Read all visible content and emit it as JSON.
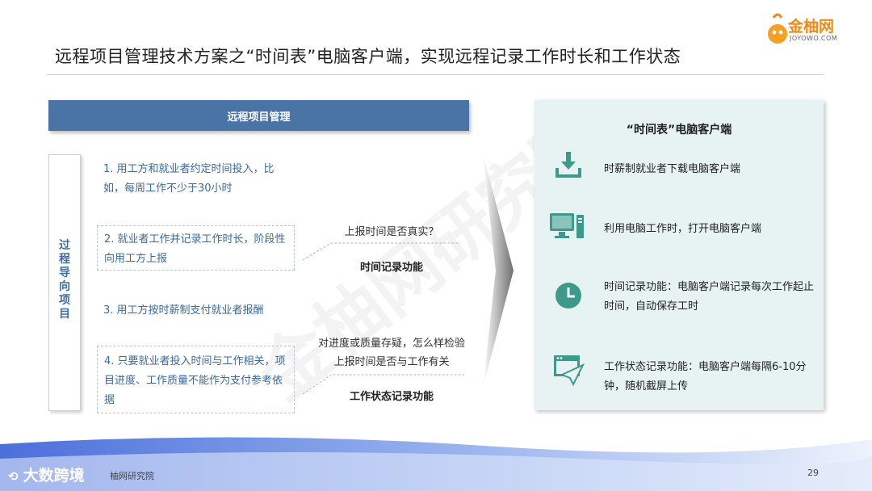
{
  "header": {
    "title": "远程项目管理技术方案之“时间表”电脑客户端，实现远程记录工作时长和工作状态",
    "logo_text": "金柚网",
    "logo_sub": "JOYOWO.COM"
  },
  "left": {
    "bar_title": "远程项目管理",
    "vertical_label": "过程导向项目",
    "steps": [
      "1.  用工方和就业者约定时间投入，比如，每周工作不少于30小时",
      "2. 就业者工作并记录工作时长，阶段性向用工方上报",
      "3. 用工方按时薪制支付就业者报酬",
      "4. 只要就业者投入时间与工作相关，项目进度、工作质量不能作为支付参考依据"
    ]
  },
  "middle": {
    "q1": "上报时间是否真实？",
    "f1": "时间记录功能",
    "q2": "对进度或质量存疑，怎么样检验上报时间是否与工作有关",
    "f2": "工作状态记录功能"
  },
  "panel": {
    "title": "“时间表”电脑客户端",
    "items": [
      {
        "icon": "download-icon",
        "text": "时薪制就业者下载电脑客户端"
      },
      {
        "icon": "computer-icon",
        "text": "利用电脑工作时，打开电脑客户端"
      },
      {
        "icon": "clock-icon",
        "text": "时间记录功能：电脑客户端记录每次工作起止时间，自动保存工时"
      },
      {
        "icon": "screenshot-send-icon",
        "text": "工作状态记录功能：电脑客户端每隔6-10分钟，随机截屏上传"
      }
    ],
    "accent": "#3d9a8b"
  },
  "footer": {
    "brand": "大数跨境",
    "source": "柚网研究院",
    "page": "29"
  },
  "watermark": "金柚网研究院",
  "colors": {
    "bar": "#4a73a6",
    "step_text": "#3a6aa0",
    "panel_bg": "#e6f3f2",
    "footer_wave": "#5b7fe0"
  }
}
